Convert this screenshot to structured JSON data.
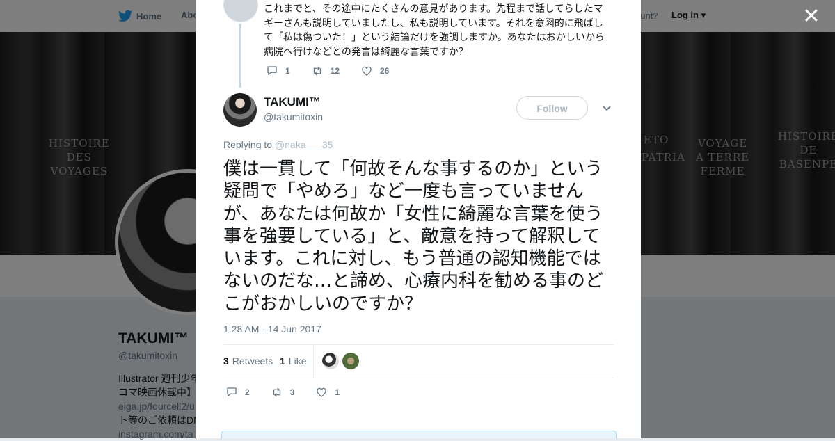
{
  "background": {
    "nav": {
      "home": "Home",
      "about": "Abo",
      "account_prompt": "ccount?",
      "login": "Log in"
    },
    "cover_texts": [
      "HISTOIRE\nDES\nVOYAGES",
      "VOYAGE\nA TERRE\nFERME",
      "HISTOIRE\nDE\nBASENPE",
      "PATRIA",
      "ETO"
    ],
    "profile": {
      "name": "TAKUMI™",
      "handle": "@takumitoxin",
      "bio_lines": [
        "Illustrator 週刊少年",
        "コマ映画休載中】",
        "eiga.jp/fourcell2/u",
        "ト等のご依頼はDM",
        "instagram.com/ta"
      ]
    }
  },
  "modal": {
    "parent_tweet": {
      "text": "これまでと、その途中にたくさんの意見があります。先程まで話してらしたマギーさんも説明していましたし、私も説明しています。それを意図的に飛ばして「私は傷ついた！」という結論だけを強調しますか。あなたはおかしいから病院へ行けなどとの発言は綺麗な言葉ですか？",
      "replies": "1",
      "retweets": "12",
      "likes": "26"
    },
    "tweet": {
      "author_name": "TAKUMI™",
      "author_handle": "@takumitoxin",
      "follow_label": "Follow",
      "replying_prefix": "Replying to",
      "replying_to": "@naka___35",
      "text": "僕は一貫して「何故そんな事するのか」という疑問で「やめろ」など一度も言っていませんが、あなたは何故か「女性に綺麗な言葉を使う事を強要している」と、敵意を持って解釈しています。これに対し、もう普通の認知機能ではないのだな…と諦め、心療内科を勧める事のどこがおかしいのですか？",
      "timestamp": "1:28 AM - 14 Jun 2017",
      "retweet_count": "3",
      "retweet_label": "Retweets",
      "like_count": "1",
      "like_label": "Like",
      "action_replies": "2",
      "action_retweets": "3",
      "action_likes": "1"
    }
  },
  "colors": {
    "accent": "#1da1f2",
    "muted": "#657786",
    "border": "#e6ecf0"
  }
}
